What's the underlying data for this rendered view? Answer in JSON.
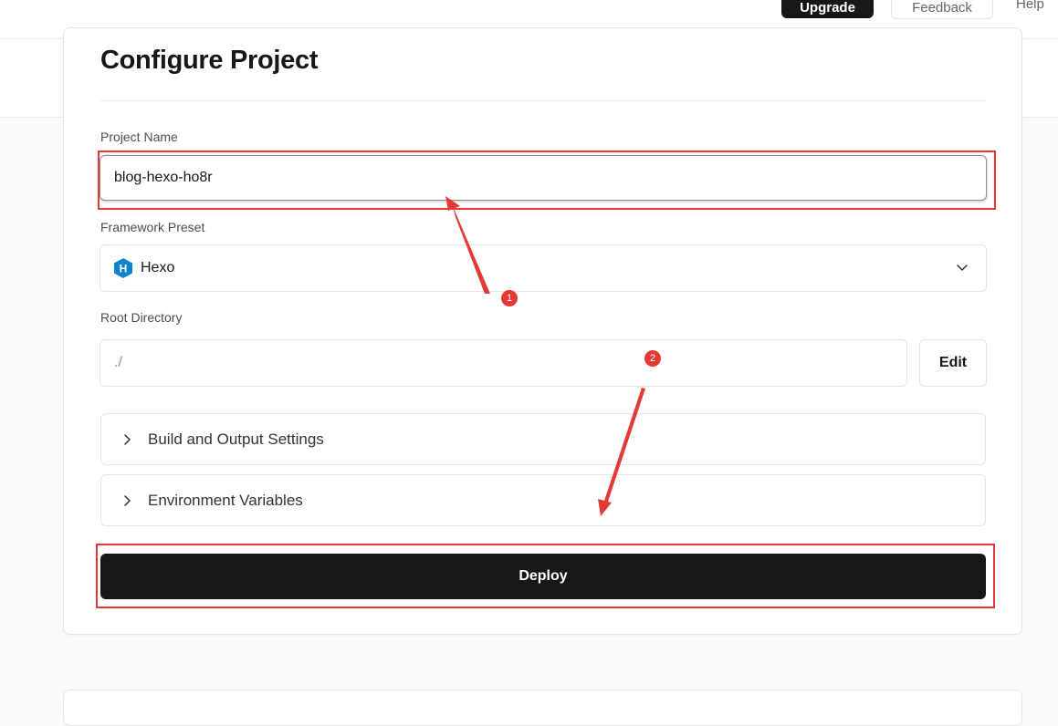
{
  "header": {
    "upgrade_label": "Upgrade",
    "feedback_label": "Feedback",
    "help_label": "Help"
  },
  "form": {
    "title": "Configure Project",
    "project_name": {
      "label": "Project Name",
      "value": "blog-hexo-ho8r"
    },
    "framework_preset": {
      "label": "Framework Preset",
      "selected": "Hexo",
      "icon": "hexo-logo-icon"
    },
    "root_directory": {
      "label": "Root Directory",
      "value": "./",
      "edit_label": "Edit"
    },
    "sections": [
      {
        "label": "Build and Output Settings"
      },
      {
        "label": "Environment Variables"
      }
    ],
    "deploy_label": "Deploy"
  },
  "annotations": {
    "color": "#e53935",
    "markers": [
      "1",
      "2"
    ]
  },
  "colors": {
    "primary_button": "#171717",
    "hexo_blue": "#0e83cd",
    "annotation_red": "#e53935"
  }
}
